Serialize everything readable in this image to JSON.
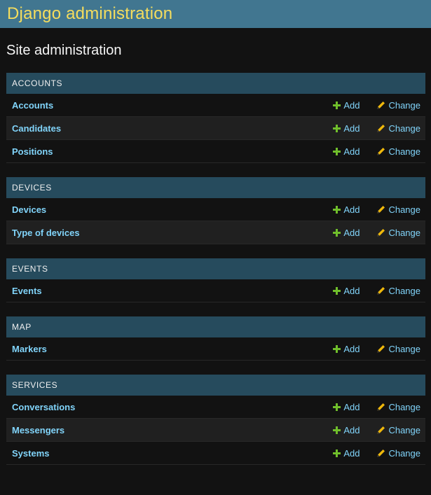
{
  "header": {
    "site_name": "Django administration"
  },
  "page": {
    "title": "Site administration"
  },
  "actions": {
    "add_label": "Add",
    "change_label": "Change"
  },
  "colors": {
    "header_bg": "#417690",
    "site_name": "#f5dd5d",
    "caption_bg": "#264b5d",
    "link": "#81d4fa",
    "add_icon": "#70bf2b",
    "change_icon": "#efb80b"
  },
  "modules": [
    {
      "caption": "ACCOUNTS",
      "models": [
        {
          "name": "Accounts"
        },
        {
          "name": "Candidates"
        },
        {
          "name": "Positions"
        }
      ]
    },
    {
      "caption": "DEVICES",
      "models": [
        {
          "name": "Devices"
        },
        {
          "name": "Type of devices"
        }
      ]
    },
    {
      "caption": "EVENTS",
      "models": [
        {
          "name": "Events"
        }
      ]
    },
    {
      "caption": "MAP",
      "models": [
        {
          "name": "Markers"
        }
      ]
    },
    {
      "caption": "SERVICES",
      "models": [
        {
          "name": "Conversations"
        },
        {
          "name": "Messengers"
        },
        {
          "name": "Systems"
        }
      ]
    }
  ]
}
